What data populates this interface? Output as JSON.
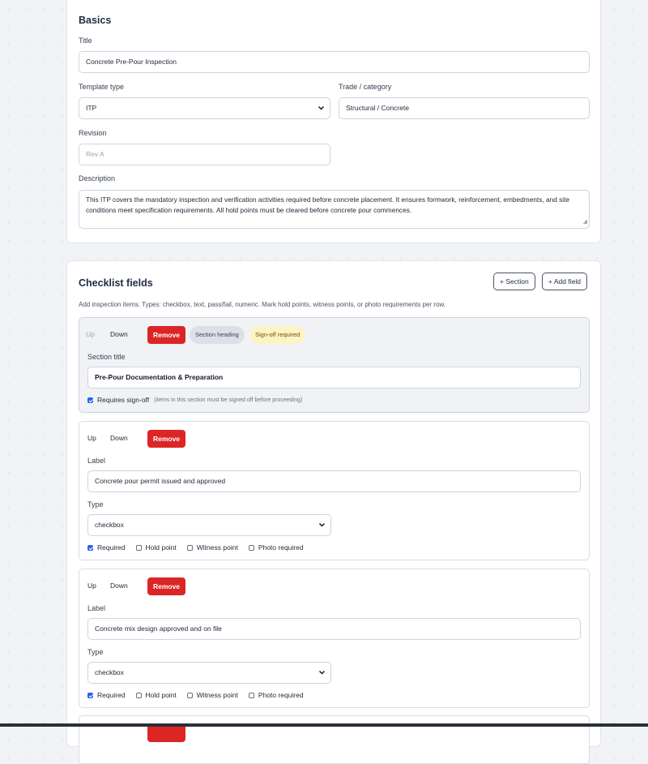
{
  "basics": {
    "heading": "Basics",
    "title_label": "Title",
    "title_value": "Concrete Pre-Pour Inspection",
    "template_type_label": "Template type",
    "template_type_value": "ITP",
    "trade_label": "Trade / category",
    "trade_value": "Structural / Concrete",
    "revision_label": "Revision",
    "revision_placeholder": "Rev A",
    "description_label": "Description",
    "description_value": "This ITP covers the mandatory inspection and verification activities required before concrete placement. It ensures formwork, reinforcement, embedments, and site conditions meet specification requirements. All hold points must be cleared before concrete pour commences."
  },
  "checklist": {
    "heading": "Checklist fields",
    "add_section_label": "+ Section",
    "add_field_label": "+ Add field",
    "hint": "Add inspection items. Types: checkbox, text, pass/fail, numeric. Mark hold points, witness points, or photo requirements per row.",
    "controls": {
      "up": "Up",
      "down": "Down",
      "remove": "Remove"
    },
    "section": {
      "badge_type": "Section heading",
      "badge_signoff": "Sign-off required",
      "title_label": "Section title",
      "title_value": "Pre-Pour Documentation & Preparation",
      "requires_signoff_label": "Requires sign-off",
      "requires_signoff_note": "(items in this section must be signed off before proceeding)",
      "requires_signoff_checked": true
    },
    "options": {
      "required": "Required",
      "hold_point": "Hold point",
      "witness_point": "Witness point",
      "photo_required": "Photo required"
    },
    "fields": [
      {
        "label_caption": "Label",
        "label_value": "Concrete pour permit issued and approved",
        "type_caption": "Type",
        "type_value": "checkbox",
        "required": true,
        "hold_point": false,
        "witness_point": false,
        "photo_required": false
      },
      {
        "label_caption": "Label",
        "label_value": "Concrete mix design approved and on file",
        "type_caption": "Type",
        "type_value": "checkbox",
        "required": true,
        "hold_point": false,
        "witness_point": false,
        "photo_required": false
      }
    ]
  },
  "icons": {
    "select_chevron": "chevron-down-icon",
    "checkbox_checked": "checkbox-checked-icon"
  },
  "colors": {
    "remove_button": "#dc2626",
    "checkbox_accent": "#2563eb",
    "signoff_badge_bg": "#fdf3c4",
    "section_badge_bg": "#dde1e7"
  }
}
